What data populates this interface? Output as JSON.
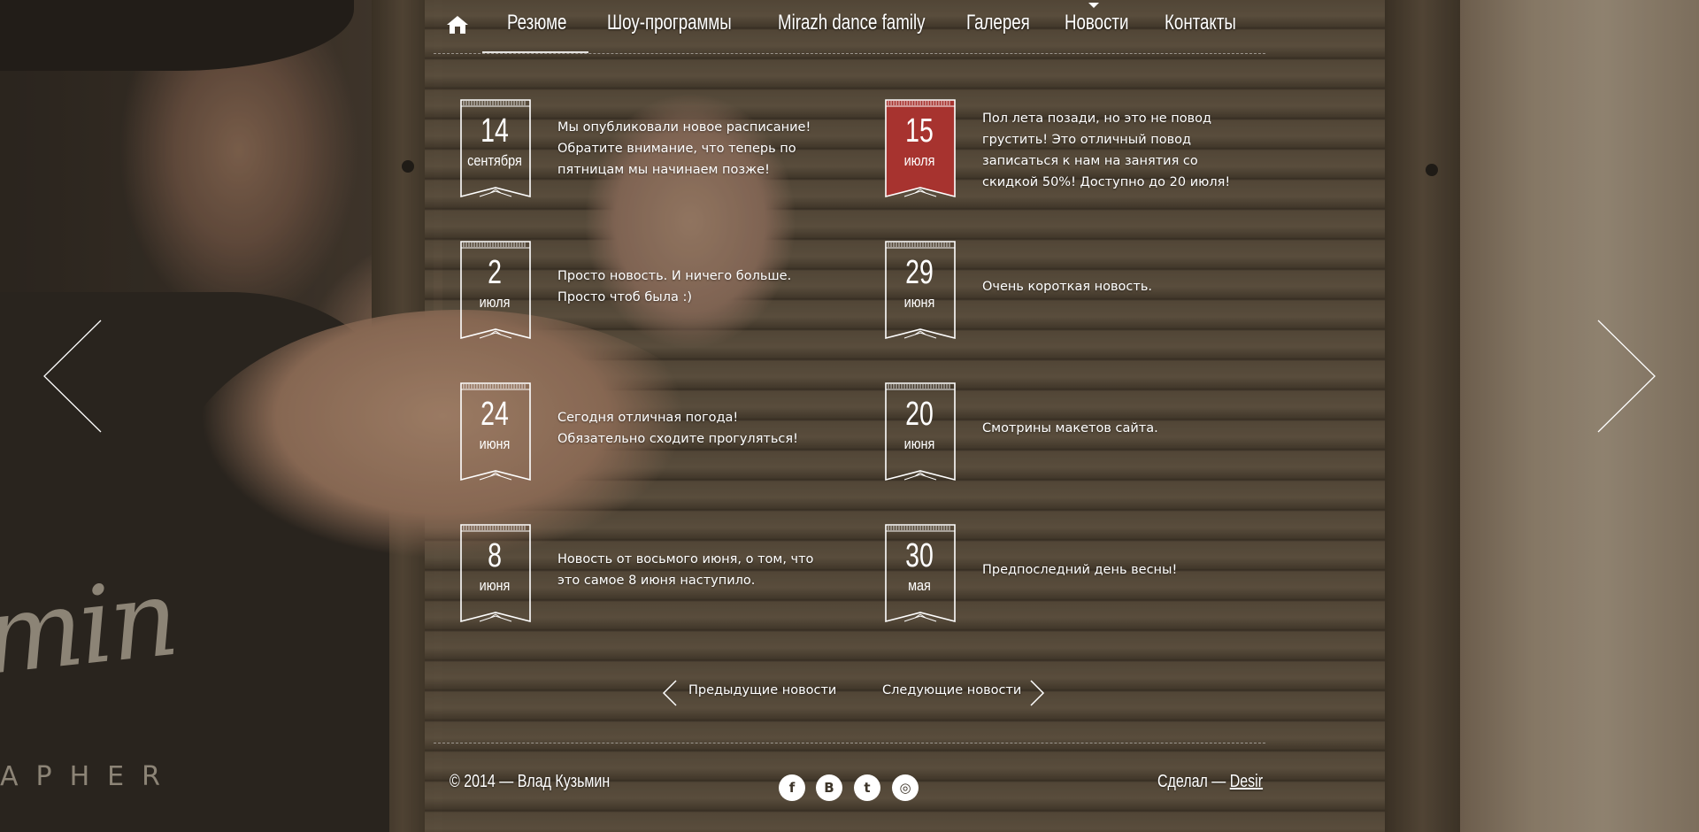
{
  "nav": {
    "home_icon": "home-icon",
    "items": [
      {
        "label": "Резюме"
      },
      {
        "label": "Шоу-программы"
      },
      {
        "label": "Mirazh dance family"
      },
      {
        "label": "Галерея"
      },
      {
        "label": "Новости"
      },
      {
        "label": "Контакты"
      }
    ]
  },
  "news": [
    {
      "day": "14",
      "month": "сентября",
      "text": "Мы опубликовали новое расписание! Обратите внимание, что теперь по пятницам мы начинаем позже!",
      "highlight": false
    },
    {
      "day": "15",
      "month": "июля",
      "text": "Пол лета позади, но это не повод грустить! Это отличный повод записаться к нам на занятия со скидкой 50%! Доступно до 20 июля!",
      "highlight": true
    },
    {
      "day": "2",
      "month": "июля",
      "text": "Просто новость. И ничего больше. Просто чтоб была :)",
      "highlight": false
    },
    {
      "day": "29",
      "month": "июня",
      "text": "Очень короткая новость.",
      "highlight": false
    },
    {
      "day": "24",
      "month": "июня",
      "text": "Сегодня отличная погода! Обязательно сходите прогуляться!",
      "highlight": false
    },
    {
      "day": "20",
      "month": "июня",
      "text": "Смотрины макетов сайта.",
      "highlight": false
    },
    {
      "day": "8",
      "month": "июня",
      "text": "Новость от восьмого июня, о том, что это самое 8 июня наступило.",
      "highlight": false
    },
    {
      "day": "30",
      "month": "мая",
      "text": "Предпоследний день весны!",
      "highlight": false
    }
  ],
  "pager": {
    "prev_label": "Предыдущие новости",
    "next_label": "Следующие новости"
  },
  "footer": {
    "copyright": "© 2014 — Влад Кузьмин",
    "credit_prefix": "Сделал — ",
    "credit_link": "Desir",
    "social": [
      {
        "icon": "facebook-icon",
        "glyph": "f"
      },
      {
        "icon": "vk-icon",
        "glyph": "B"
      },
      {
        "icon": "twitter-icon",
        "glyph": "t"
      },
      {
        "icon": "instagram-icon",
        "glyph": "◎"
      }
    ]
  },
  "background_logo": {
    "script": "min",
    "sub": "APHER"
  },
  "colors": {
    "highlight_badge": "#a7332f",
    "text": "#ffffff"
  }
}
